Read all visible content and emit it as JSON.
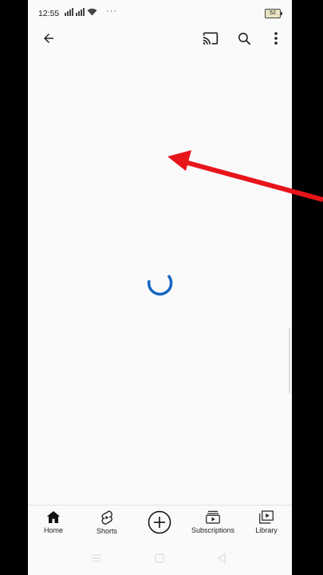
{
  "status_bar": {
    "time": "12:55",
    "battery": "52",
    "more_dots": "···"
  },
  "app_bar": {
    "icons": [
      "back-arrow-icon",
      "cast-icon",
      "search-icon",
      "more-vert-icon"
    ]
  },
  "content": {
    "state": "loading",
    "spinner_color": "#1565c0"
  },
  "bottom_nav": {
    "home": "Home",
    "shorts": "Shorts",
    "subscriptions": "Subscriptions",
    "library": "Library"
  },
  "colors": {
    "annotation_arrow": "#e8141b",
    "background": "#fafafa"
  }
}
